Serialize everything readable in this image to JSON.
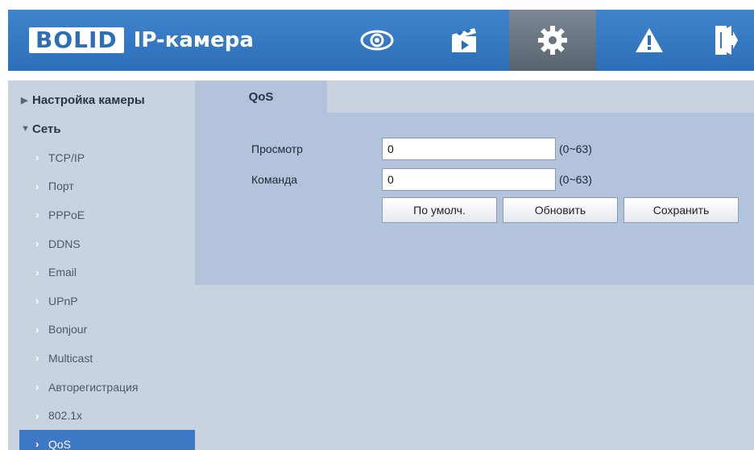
{
  "header": {
    "logo_brand": "BOLID",
    "logo_product": "IP-камера",
    "nav_icons": [
      "eye-icon",
      "clapperboard-icon",
      "gear-icon",
      "warning-icon",
      "logout-icon"
    ],
    "active_nav": "gear-icon",
    "colors": {
      "header": "#2c6fb8",
      "active": "#59636e"
    }
  },
  "sidebar": {
    "group_camera": "Настройка камеры",
    "group_network": "Сеть",
    "items": [
      "TCP/IP",
      "Порт",
      "PPPoE",
      "DDNS",
      "Email",
      "UPnP",
      "Bonjour",
      "Multicast",
      "Авторегистрация",
      "802.1x",
      "QoS"
    ],
    "active_item": "QoS",
    "colors": {
      "background": "#c9d3e0",
      "active": "#3d78c4"
    }
  },
  "main": {
    "tab_label": "QoS",
    "view_label": "Просмотр",
    "view_value": "0",
    "view_range": "(0~63)",
    "command_label": "Команда",
    "command_value": "0",
    "command_range": "(0~63)",
    "default_button": "По умолч.",
    "refresh_button": "Обновить",
    "save_button": "Сохранить"
  }
}
